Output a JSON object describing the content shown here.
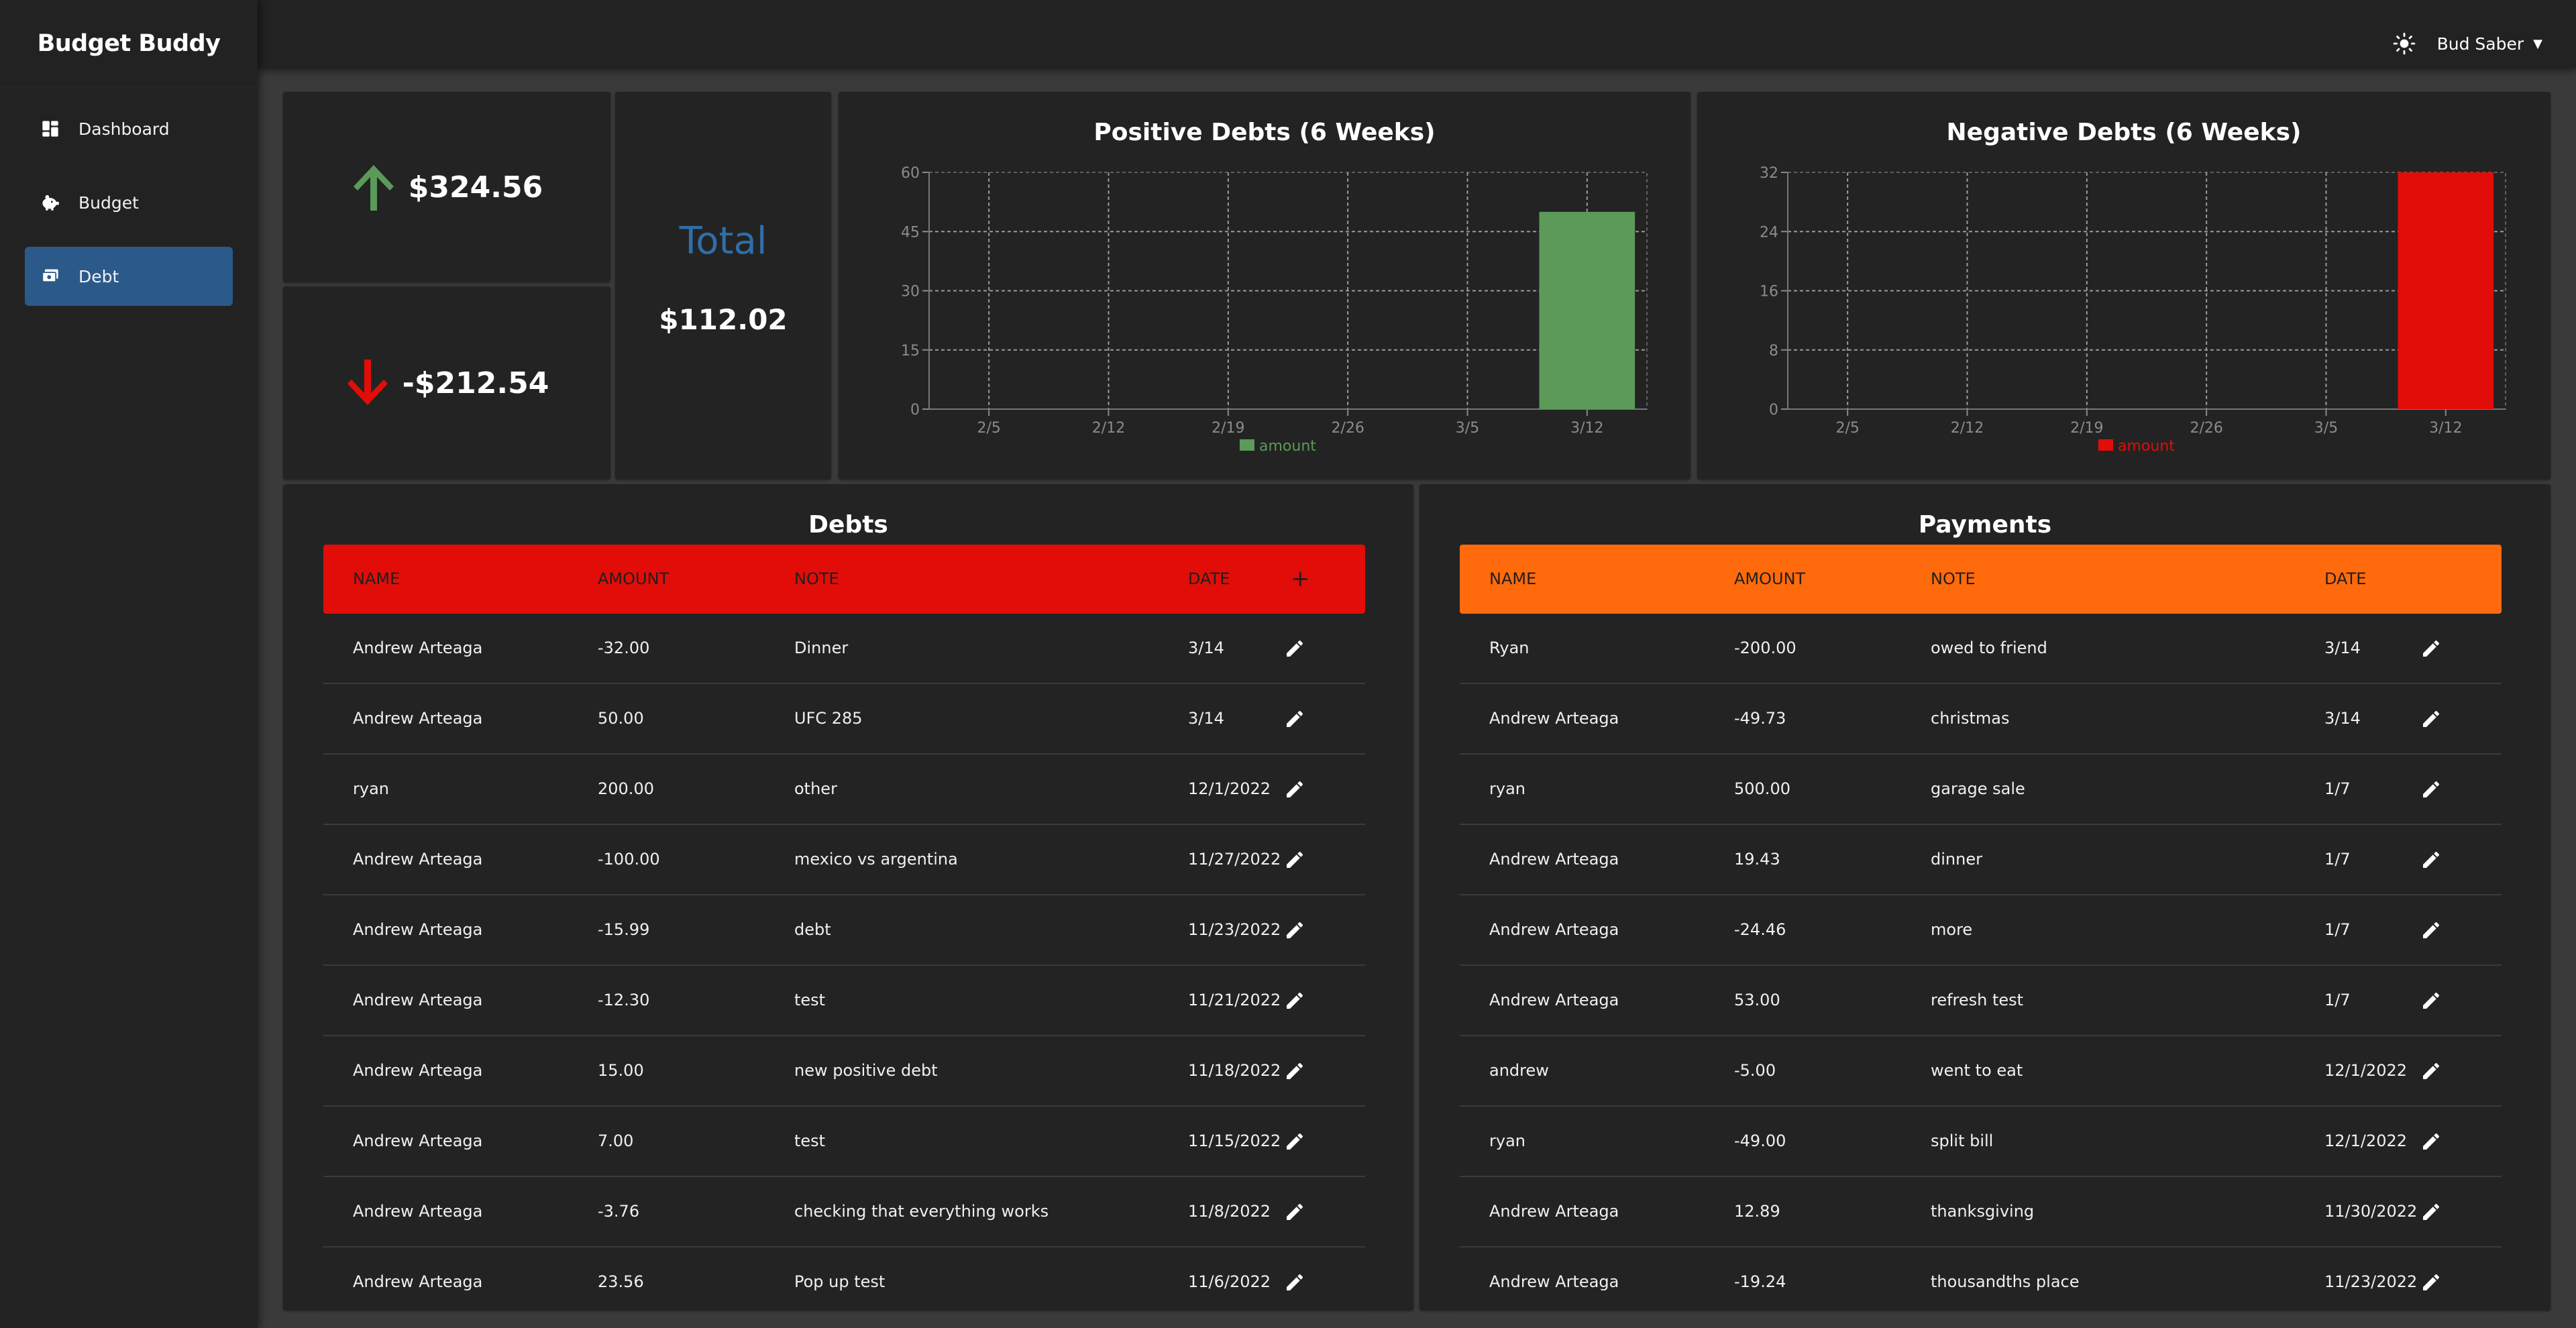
{
  "app": {
    "title": "Budget Buddy"
  },
  "sidebar": {
    "items": [
      {
        "label": "Dashboard",
        "icon": "dashboard-icon"
      },
      {
        "label": "Budget",
        "icon": "piggy-bank-icon"
      },
      {
        "label": "Debt",
        "icon": "money-icon",
        "active": true
      }
    ]
  },
  "topbar": {
    "user_name": "Bud Saber",
    "theme_icon": "sun-icon"
  },
  "stats": {
    "positive": "$324.56",
    "negative": "-$212.54",
    "total_label": "Total",
    "total_value": "$112.02",
    "colors": {
      "positive": "#5b9a58",
      "negative": "#e20d08",
      "total_label": "#2f6ea9"
    }
  },
  "chart_data": [
    {
      "type": "bar",
      "title": "Positive Debts (6 Weeks)",
      "categories": [
        "2/5",
        "2/12",
        "2/19",
        "2/26",
        "3/5",
        "3/12"
      ],
      "series": [
        {
          "name": "amount",
          "values": [
            0,
            0,
            0,
            0,
            0,
            50
          ]
        }
      ],
      "ylim": [
        0,
        60
      ],
      "yticks": [
        0,
        15,
        30,
        45,
        60
      ],
      "grid": true,
      "legend": "bottom",
      "color": "#5b9a58"
    },
    {
      "type": "bar",
      "title": "Negative Debts (6 Weeks)",
      "categories": [
        "2/5",
        "2/12",
        "2/19",
        "2/26",
        "3/5",
        "3/12"
      ],
      "series": [
        {
          "name": "amount",
          "values": [
            0,
            0,
            0,
            0,
            0,
            32
          ]
        }
      ],
      "ylim": [
        0,
        32
      ],
      "yticks": [
        0,
        8,
        16,
        24,
        32
      ],
      "grid": true,
      "legend": "bottom",
      "color": "#e20d08"
    }
  ],
  "debts": {
    "title": "Debts",
    "headers": {
      "name": "NAME",
      "amount": "AMOUNT",
      "note": "NOTE",
      "date": "DATE",
      "add": "+"
    },
    "header_color": "#e20d08",
    "rows": [
      {
        "name": "Andrew Arteaga",
        "amount": "-32.00",
        "note": "Dinner",
        "date": "3/14"
      },
      {
        "name": "Andrew Arteaga",
        "amount": "50.00",
        "note": "UFC 285",
        "date": "3/14"
      },
      {
        "name": "ryan",
        "amount": "200.00",
        "note": "other",
        "date": "12/1/2022"
      },
      {
        "name": "Andrew Arteaga",
        "amount": "-100.00",
        "note": "mexico vs argentina",
        "date": "11/27/2022"
      },
      {
        "name": "Andrew Arteaga",
        "amount": "-15.99",
        "note": "debt",
        "date": "11/23/2022"
      },
      {
        "name": "Andrew Arteaga",
        "amount": "-12.30",
        "note": "test",
        "date": "11/21/2022"
      },
      {
        "name": "Andrew Arteaga",
        "amount": "15.00",
        "note": "new positive debt",
        "date": "11/18/2022"
      },
      {
        "name": "Andrew Arteaga",
        "amount": "7.00",
        "note": "test",
        "date": "11/15/2022"
      },
      {
        "name": "Andrew Arteaga",
        "amount": "-3.76",
        "note": "checking that everything works",
        "date": "11/8/2022"
      },
      {
        "name": "Andrew Arteaga",
        "amount": "23.56",
        "note": "Pop up test",
        "date": "11/6/2022"
      }
    ]
  },
  "payments": {
    "title": "Payments",
    "headers": {
      "name": "NAME",
      "amount": "AMOUNT",
      "note": "NOTE",
      "date": "DATE"
    },
    "header_color": "#ff6a0d",
    "rows": [
      {
        "name": "Ryan",
        "amount": "-200.00",
        "note": "owed to friend",
        "date": "3/14"
      },
      {
        "name": "Andrew Arteaga",
        "amount": "-49.73",
        "note": "christmas",
        "date": "3/14"
      },
      {
        "name": "ryan",
        "amount": "500.00",
        "note": "garage sale",
        "date": "1/7"
      },
      {
        "name": "Andrew Arteaga",
        "amount": "19.43",
        "note": "dinner",
        "date": "1/7"
      },
      {
        "name": "Andrew Arteaga",
        "amount": "-24.46",
        "note": "more",
        "date": "1/7"
      },
      {
        "name": "Andrew Arteaga",
        "amount": "53.00",
        "note": "refresh test",
        "date": "1/7"
      },
      {
        "name": "andrew",
        "amount": "-5.00",
        "note": "went to eat",
        "date": "12/1/2022"
      },
      {
        "name": "ryan",
        "amount": "-49.00",
        "note": "split bill",
        "date": "12/1/2022"
      },
      {
        "name": "Andrew Arteaga",
        "amount": "12.89",
        "note": "thanksgiving",
        "date": "11/30/2022"
      },
      {
        "name": "Andrew Arteaga",
        "amount": "-19.24",
        "note": "thousandths place",
        "date": "11/23/2022"
      }
    ]
  }
}
